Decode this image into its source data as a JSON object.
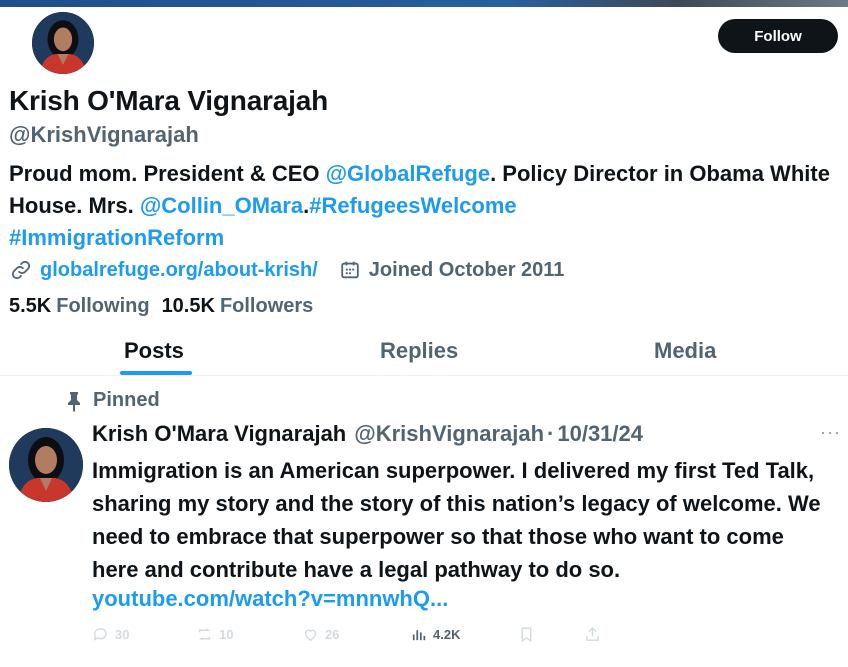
{
  "colors": {
    "accent": "#1d9bf0",
    "text": "#0f1419",
    "muted": "#536471",
    "button": "#0f1419"
  },
  "profile": {
    "name": "Krish O'Mara Vignarajah",
    "handle": "@KrishVignarajah",
    "follow_label": "Follow",
    "bio": {
      "part1": "Proud mom. President & CEO ",
      "mention1": "@GlobalRefuge",
      "part2": ". Policy Director in Obama White House. Mrs. ",
      "mention2": "@Collin_OMara",
      "part3": ".",
      "hashtag1": "#RefugeesWelcome",
      "hashtag2": "#ImmigrationReform"
    },
    "website": "globalrefuge.org/about-krish/",
    "joined": "Joined October 2011",
    "following_count": "5.5K",
    "following_label": "Following",
    "followers_count": "10.5K",
    "followers_label": "Followers"
  },
  "tabs": [
    {
      "label": "Posts",
      "active": true
    },
    {
      "label": "Replies",
      "active": false
    },
    {
      "label": "Media",
      "active": false
    }
  ],
  "pinned_post": {
    "pinned_label": "Pinned",
    "author": "Krish O'Mara Vignarajah",
    "handle": "@KrishVignarajah",
    "separator": "·",
    "date": "10/31/24",
    "more": "···",
    "text": "Immigration is an American superpower. I delivered my first Ted Talk, sharing my story and the story of this nation’s legacy of welcome. We need to embrace that superpower so that those who want to come here and contribute have a legal pathway to do so.",
    "link": "youtube.com/watch?v=mnnwhQ...",
    "replies": "30",
    "reposts": "10",
    "likes": "26",
    "views": "4.2K"
  },
  "icons": {
    "website": "link-icon",
    "joined": "calendar-icon",
    "pinned": "pin-icon",
    "replies": "reply-icon",
    "reposts": "repost-icon",
    "likes": "heart-icon",
    "views": "views-icon",
    "bookmark": "bookmark-icon",
    "share": "share-icon"
  }
}
